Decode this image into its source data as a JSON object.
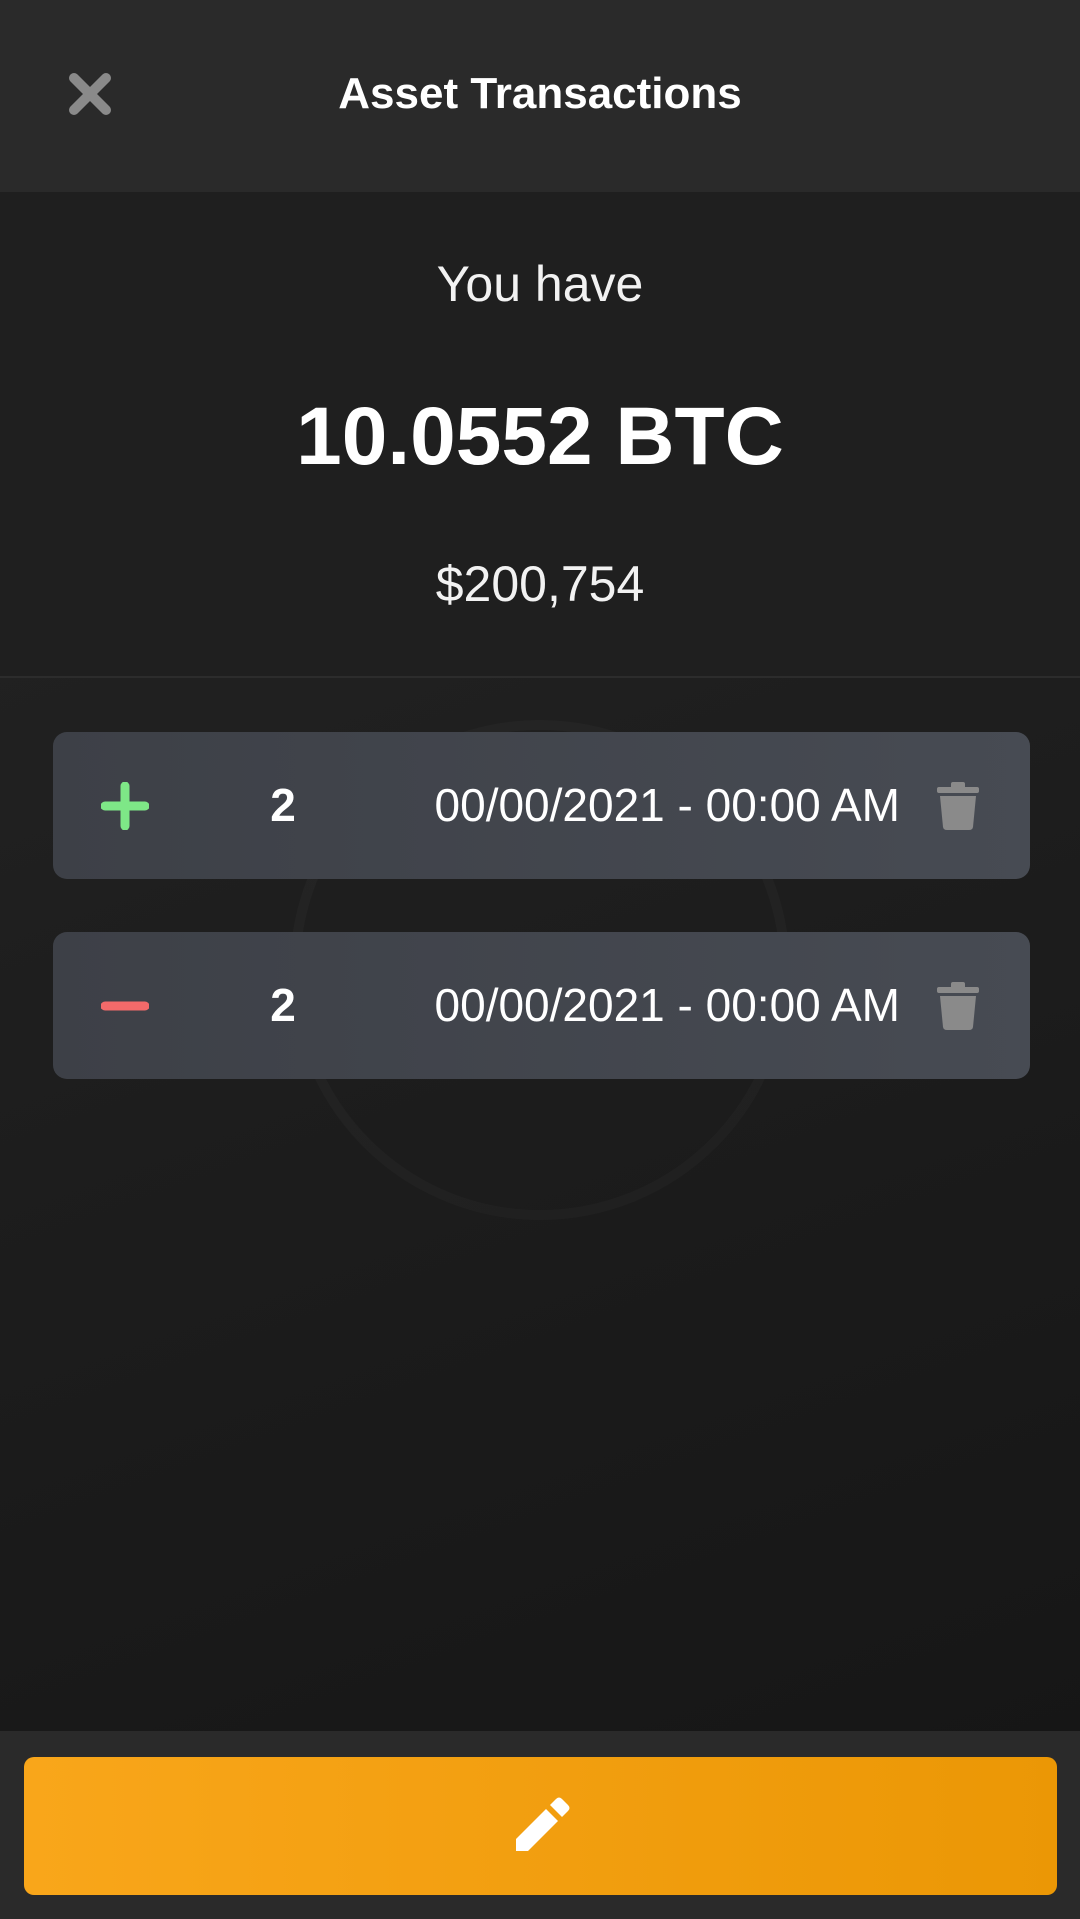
{
  "header": {
    "title": "Asset Transactions",
    "close_icon": "close-icon"
  },
  "summary": {
    "label": "You have",
    "amount": "10.0552 BTC",
    "fiat_value": "$200,754"
  },
  "transactions": [
    {
      "type": "buy",
      "type_icon": "plus-icon",
      "type_color": "#7ee787",
      "quantity": "2",
      "datetime": "00/00/2021 - 00:00 AM",
      "delete_icon": "trash-icon"
    },
    {
      "type": "sell",
      "type_icon": "minus-icon",
      "type_color": "#f26a6a",
      "quantity": "2",
      "datetime": "00/00/2021 - 00:00 AM",
      "delete_icon": "trash-icon"
    }
  ],
  "footer": {
    "action_icon": "pencil-icon",
    "accent": "#f5a20f"
  },
  "colors": {
    "background": "#1c1c1c",
    "header": "#2a2a2a",
    "row": "#42454c",
    "muted_icon": "#8a8a8a",
    "positive": "#7ee787",
    "negative": "#f26a6a",
    "accent": "#f5a20f"
  }
}
